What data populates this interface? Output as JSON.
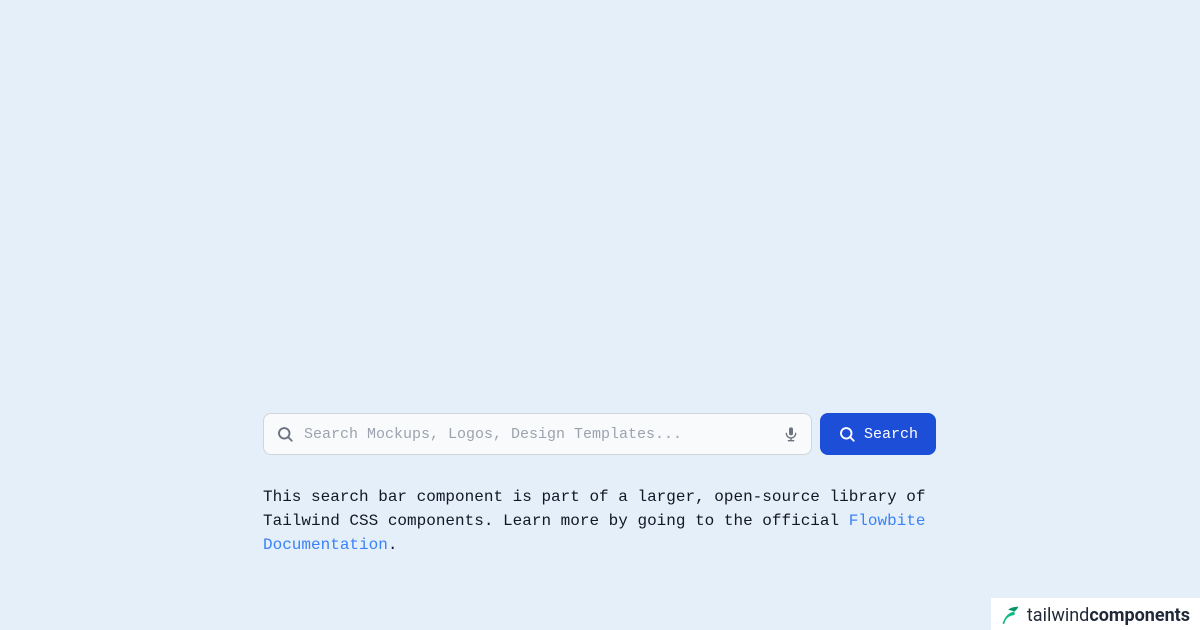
{
  "search": {
    "placeholder": "Search Mockups, Logos, Design Templates...",
    "button_label": "Search"
  },
  "description": {
    "text_before_link": "This search bar component is part of a larger, open-source library of Tailwind CSS components. Learn more by going to the official ",
    "link_text": "Flowbite Documentation",
    "text_after_link": "."
  },
  "footer": {
    "brand_first": "tailwind",
    "brand_second": "components"
  }
}
